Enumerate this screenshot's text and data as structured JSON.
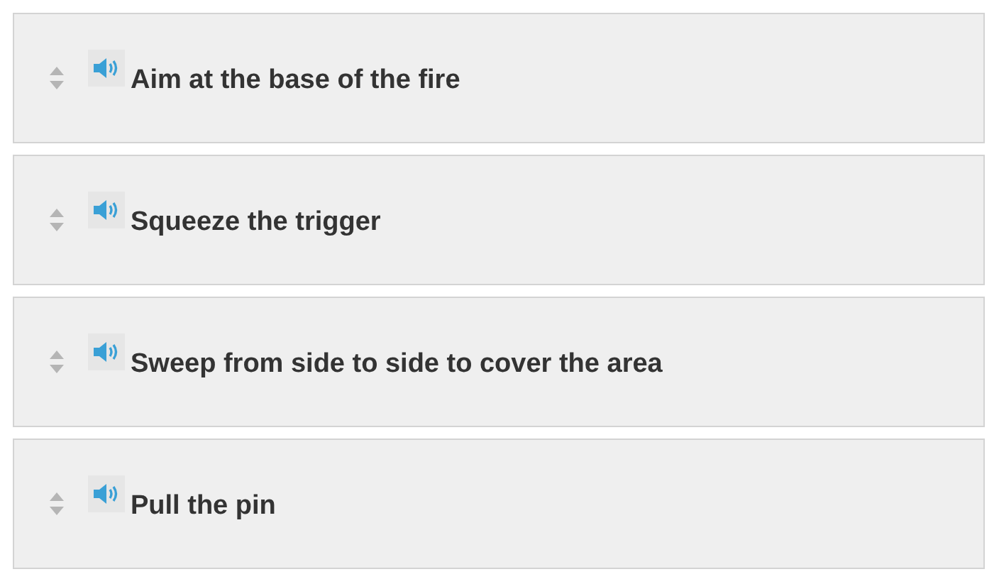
{
  "items": [
    {
      "text": "Aim at the base of the fire"
    },
    {
      "text": "Squeeze the trigger"
    },
    {
      "text": "Sweep from side to side to cover the area"
    },
    {
      "text": "Pull the pin"
    }
  ]
}
